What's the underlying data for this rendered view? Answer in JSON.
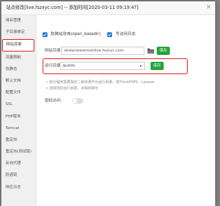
{
  "dialog": {
    "title": "站点修改[live.fszxyc.com] -- 添加时间[2020-03-11 09:19:47]",
    "close_icon": "close-icon"
  },
  "sidebar": {
    "items": [
      {
        "label": "域名管理",
        "active": false
      },
      {
        "label": "子目录绑定",
        "active": false
      },
      {
        "label": "网站目录",
        "active": true
      },
      {
        "label": "流量限制",
        "active": false
      },
      {
        "label": "伪静态",
        "active": false
      },
      {
        "label": "默认文档",
        "active": false
      },
      {
        "label": "配置文件",
        "active": false
      },
      {
        "label": "SSL",
        "active": false
      },
      {
        "label": "PHP版本",
        "active": false
      },
      {
        "label": "Tomcat",
        "active": false
      },
      {
        "label": "重定向",
        "active": false
      },
      {
        "label": "重定向(测试版)",
        "active": false
      },
      {
        "label": "反向代理",
        "active": false
      },
      {
        "label": "防盗链",
        "active": false
      },
      {
        "label": "响应日志",
        "active": false
      }
    ]
  },
  "options": {
    "anti_xss_label": "防跨站攻击(open_basedir)",
    "anti_xss_checked": true,
    "write_log_label": "写访问日志",
    "write_log_checked": true
  },
  "site_dir": {
    "label": "网站目录",
    "value": "/www/wwwroot/live.fszxyc.com",
    "folder_icon": "folder-icon",
    "save_label": "保存"
  },
  "run_dir": {
    "label": "运行目录",
    "value": "/public",
    "save_label": "保存"
  },
  "tips": [
    "部分程序需要指定二级目录作为运行目录，如ThinkPHP5，Laravel",
    "选择您的运行目录，点保存即可"
  ],
  "password_access": {
    "label": "密码访问",
    "enabled": false
  },
  "colors": {
    "accent_green": "#20a53a",
    "highlight_red": "#e0141e"
  }
}
